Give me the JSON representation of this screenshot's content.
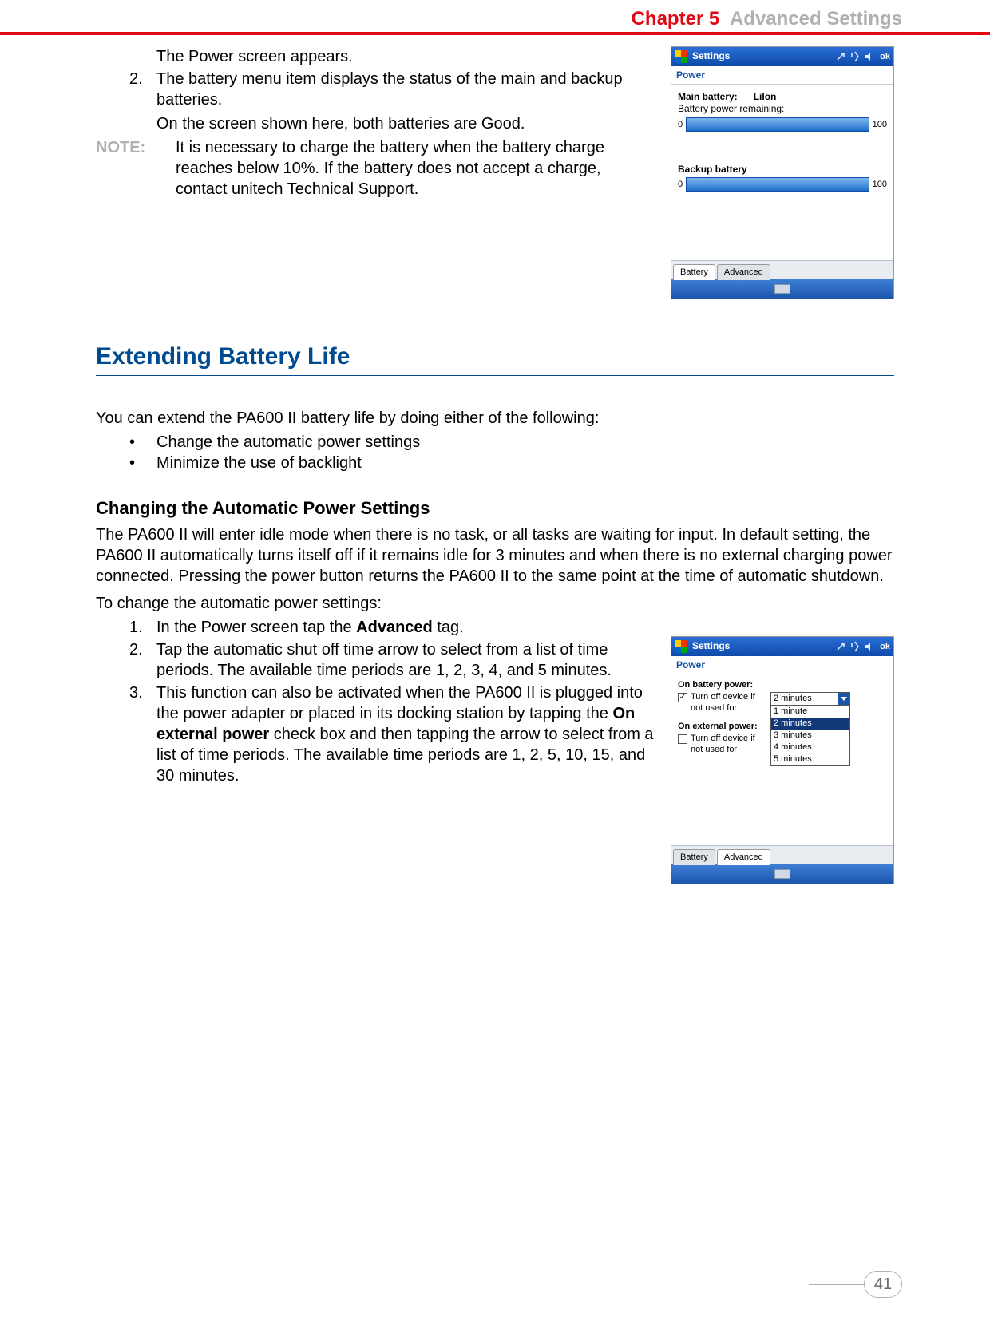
{
  "header": {
    "chapter": "Chapter 5",
    "title": "Advanced Settings"
  },
  "top": {
    "line1": "The Power screen appears.",
    "step2_num": "2.",
    "step2": "The battery menu item displays the status of the main and backup batteries.",
    "step2b": "On the screen shown here, both batteries are Good.",
    "note_label": "NOTE:",
    "note_text": "It is necessary to charge the battery when the battery charge reaches below 10%. If the battery does not accept a charge, contact unitech Technical Support."
  },
  "section": {
    "title": "Extending Battery Life",
    "intro": "You can extend the PA600 II battery life by doing either of the following:",
    "bullets": [
      "Change the automatic power settings",
      "Minimize the use of backlight"
    ],
    "sub_title": "Changing the Automatic Power Settings",
    "para1": "The PA600 II will enter idle mode when there is no task, or all tasks are waiting for input. In default setting, the PA600 II automatically turns itself off if it remains idle for 3 minutes and when there is no external charging power connected. Pressing the power button returns the PA600 II to the same point at the time of automatic shutdown.",
    "para2": "To change the automatic power settings:",
    "step1_num": "1.",
    "step1_a": "In the Power screen tap the ",
    "step1_b": "Advanced",
    "step1_c": " tag.",
    "step2_num": "2.",
    "step2": "Tap the automatic shut off time arrow to select from a list of time periods. The available time periods are 1, 2, 3, 4, and 5 minutes.",
    "step3_num": "3.",
    "step3_a": "This function can also be activated when the PA600 II is plugged into the power adapter or placed in its docking station by tapping the ",
    "step3_b": "On external power",
    "step3_c": " check box and then tapping the arrow to select from a list of time periods. The available time periods are 1, 2, 5, 10, 15, and 30 minutes."
  },
  "shot1": {
    "titlebar": "Settings",
    "ok": "ok",
    "sub": "Power",
    "main_label": "Main battery:",
    "main_type": "LiIon",
    "main_sub": "Battery power remaining:",
    "zero": "0",
    "hundred": "100",
    "backup_label": "Backup battery",
    "tab1": "Battery",
    "tab2": "Advanced"
  },
  "shot2": {
    "titlebar": "Settings",
    "ok": "ok",
    "sub": "Power",
    "opt1_title": "On battery power:",
    "opt1_text": "Turn off device if not used for",
    "opt1_checked": "✓",
    "dd_value": "2 minutes",
    "dd_options": [
      "1 minute",
      "2 minutes",
      "3 minutes",
      "4 minutes",
      "5 minutes"
    ],
    "opt2_title": "On external power:",
    "opt2_text": "Turn off device if not used for",
    "tab1": "Battery",
    "tab2": "Advanced"
  },
  "page_number": "41"
}
